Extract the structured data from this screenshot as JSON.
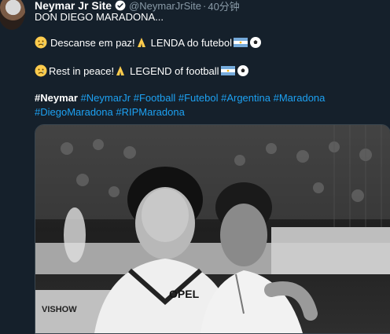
{
  "tweet": {
    "author_name": "Neymar Jr Site",
    "handle": "@NeymarJrSite",
    "separator": "·",
    "time": "40分钟",
    "line1": "DON DIEGO MARADONA...",
    "line2_text": "Descanse em paz!",
    "line2_text2": "LENDA do futebol",
    "line3_text": "Rest in peace!",
    "line3_text2": "LEGEND of football",
    "hashtags": [
      "#Neymar",
      "#NeymarJr",
      "#Football",
      "#Futebol",
      "#Argentina",
      "#Maradona",
      "#DiegoMaradona",
      "#RIPMaradona"
    ],
    "photo_text": "OPEL",
    "photo_sign": "VISHOW"
  },
  "icons": {
    "verified": "verified-badge-icon",
    "sad_face": "crying-face-emoji",
    "praying": "folded-hands-emoji",
    "flag": "argentina-flag-emoji",
    "ball": "soccer-ball-emoji"
  },
  "colors": {
    "background": "#15202b",
    "link": "#1da1f2",
    "muted": "#8899a6"
  }
}
